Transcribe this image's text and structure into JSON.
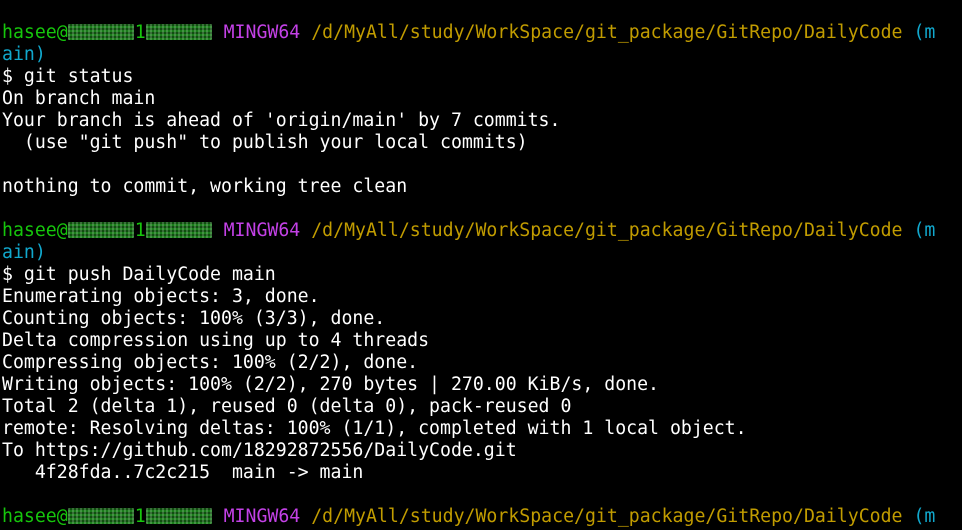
{
  "window": {
    "title": "MINGW64"
  },
  "theme": {
    "background": "#000000",
    "foreground": "#ffffff",
    "user_color": "#16c60c",
    "env_color": "#c341e6",
    "path_color": "#c19c00",
    "branch_color": "#11a8cd"
  },
  "prompts": [
    {
      "user": "hasee@",
      "user_suffix": "1",
      "env": "MINGW64",
      "path": "/d/MyAll/study/WorkSpace/git_package/GitRepo/DailyCode",
      "branch_open": "(m",
      "branch_close": "ain)"
    },
    {
      "user": "hasee@",
      "user_suffix": "1",
      "env": "MINGW64",
      "path": "/d/MyAll/study/WorkSpace/git_package/GitRepo/DailyCode",
      "branch_open": "(m",
      "branch_close": "ain)"
    },
    {
      "user": "hasee@",
      "user_suffix": "1",
      "env": "MINGW64",
      "path": "/d/MyAll/study/WorkSpace/git_package/GitRepo/DailyCode",
      "branch_open": "(m",
      "branch_close": ""
    }
  ],
  "commands": [
    "$ git status",
    "$ git push DailyCode main"
  ],
  "output_status": [
    "On branch main",
    "Your branch is ahead of 'origin/main' by 7 commits.",
    "  (use \"git push\" to publish your local commits)",
    "",
    "nothing to commit, working tree clean"
  ],
  "output_push": [
    "Enumerating objects: 3, done.",
    "Counting objects: 100% (3/3), done.",
    "Delta compression using up to 4 threads",
    "Compressing objects: 100% (2/2), done.",
    "Writing objects: 100% (2/2), 270 bytes | 270.00 KiB/s, done.",
    "Total 2 (delta 1), reused 0 (delta 0), pack-reused 0",
    "remote: Resolving deltas: 100% (1/1), completed with 1 local object.",
    "To https://github.com/18292872556/DailyCode.git",
    "   4f28fda..7c2c215  main -> main"
  ]
}
